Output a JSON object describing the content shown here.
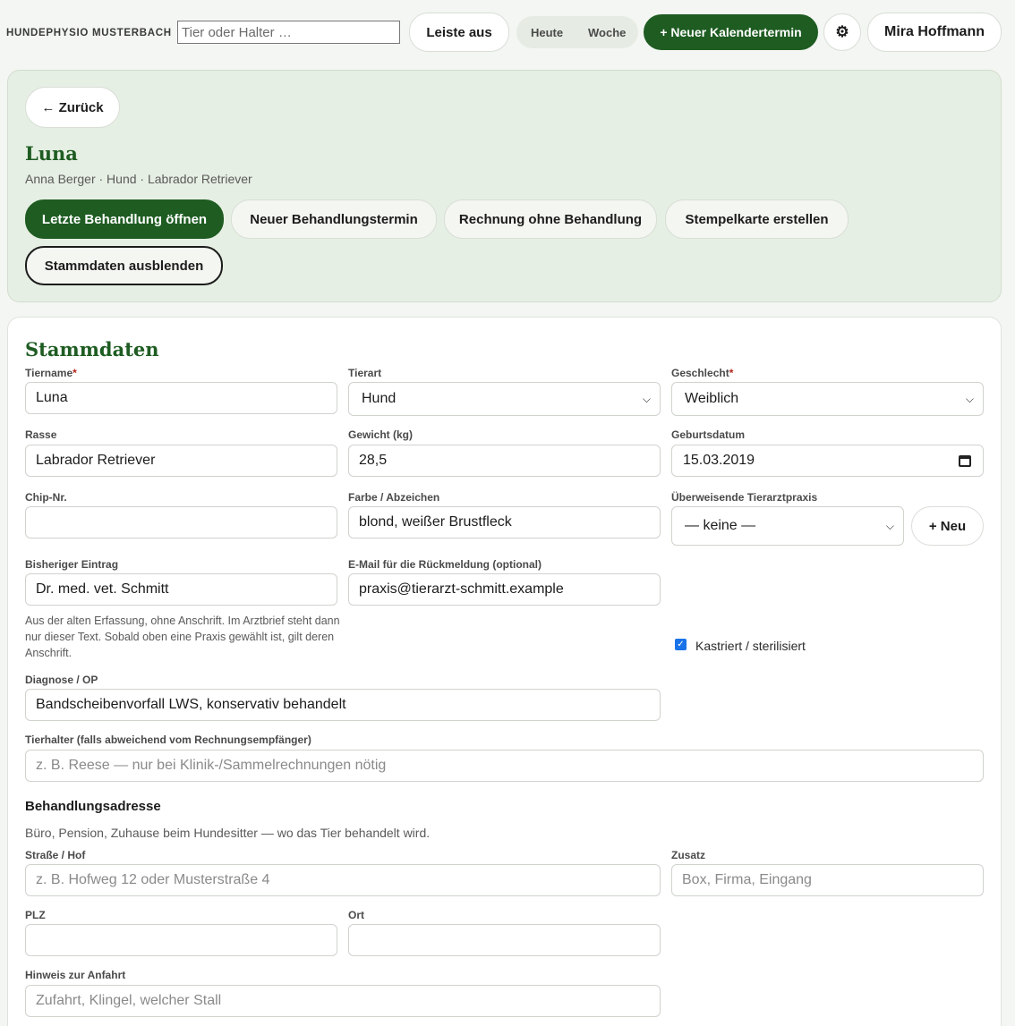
{
  "topbar": {
    "brand": "HUNDEPHYSIO MUSTERBACH",
    "search_placeholder": "Tier oder Halter …",
    "sidebar_toggle": "Leiste aus",
    "view_today": "Heute",
    "view_week": "Woche",
    "new_appointment": "+ Neuer Kalendertermin",
    "settings_icon": "⚙",
    "user": "Mira Hoffmann"
  },
  "header": {
    "back": "← Zurück",
    "name": "Luna",
    "subtitle": "Anna Berger · Hund · Labrador Retriever",
    "actions": {
      "open_last": "Letzte Behandlung öffnen",
      "new_treatment": "Neuer Behandlungstermin",
      "invoice": "Rechnung ohne Behandlung",
      "stamp_card": "Stempelkarte erstellen",
      "hide_master": "Stammdaten ausblenden"
    }
  },
  "form": {
    "title": "Stammdaten",
    "fields": {
      "name": {
        "label": "Tiername",
        "value": "Luna"
      },
      "species": {
        "label": "Tierart",
        "value": "Hund"
      },
      "sex": {
        "label": "Geschlecht",
        "value": "Weiblich"
      },
      "breed": {
        "label": "Rasse",
        "value": "Labrador Retriever"
      },
      "weight": {
        "label": "Gewicht (kg)",
        "value": "28,5"
      },
      "birthdate": {
        "label": "Geburtsdatum",
        "value": "15.03.2019"
      },
      "chip": {
        "label": "Chip-Nr.",
        "value": ""
      },
      "color": {
        "label": "Farbe / Abzeichen",
        "value": "blond, weißer Brustfleck"
      },
      "vet": {
        "label": "Überweisende Tierarztpraxis",
        "value": "— keine —",
        "new_button": "+ Neu"
      },
      "previous": {
        "label": "Bisheriger Eintrag",
        "value": "Dr. med. vet. Schmitt"
      },
      "email": {
        "label": "E-Mail für die Rückmeldung (optional)",
        "value": "praxis@tierarzt-schmitt.example"
      },
      "previous_help": "Aus der alten Erfassung, ohne Anschrift. Im Arztbrief steht dann nur dieser Text. Sobald oben eine Praxis gewählt ist, gilt deren Anschrift.",
      "neutered": {
        "label": "Kastriert / sterilisiert",
        "checked": true
      },
      "diagnosis": {
        "label": "Diagnose / OP",
        "value": "Bandscheibenvorfall LWS, konservativ behandelt"
      },
      "owner": {
        "label": "Tierhalter (falls abweichend vom Rechnungsempfänger)",
        "placeholder": "z. B. Reese — nur bei Klinik-/Sammelrechnungen nötig"
      }
    },
    "address": {
      "title": "Behandlungsadresse",
      "subtitle": "Büro, Pension, Zuhause beim Hundesitter — wo das Tier behandelt wird.",
      "street": {
        "label": "Straße / Hof",
        "placeholder": "z. B. Hofweg 12 oder Musterstraße 4"
      },
      "extra": {
        "label": "Zusatz",
        "placeholder": "Box, Firma, Eingang"
      },
      "zip": {
        "label": "PLZ",
        "placeholder": ""
      },
      "city": {
        "label": "Ort",
        "placeholder": ""
      },
      "directions": {
        "label": "Hinweis zur Anfahrt",
        "placeholder": "Zufahrt, Klingel, welcher Stall"
      }
    },
    "required_mark": "*"
  }
}
